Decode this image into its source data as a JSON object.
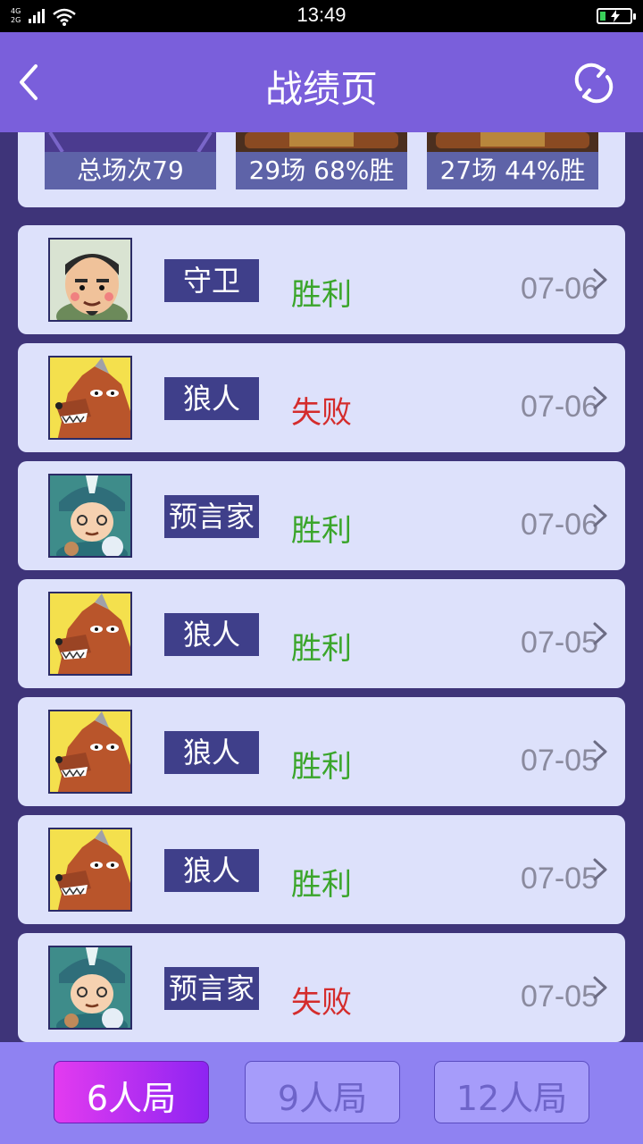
{
  "status_bar": {
    "network": "4G 2G",
    "time": "13:49"
  },
  "header": {
    "title": "战绩页"
  },
  "summary": {
    "stats": [
      {
        "label": "总场次79"
      },
      {
        "label": "29场 68%胜"
      },
      {
        "label": "27场 44%胜"
      }
    ]
  },
  "records": [
    {
      "role": "守卫",
      "result": "胜利",
      "outcome": "win",
      "date": "07-06",
      "avatar": "guard"
    },
    {
      "role": "狼人",
      "result": "失败",
      "outcome": "lose",
      "date": "07-06",
      "avatar": "werewolf"
    },
    {
      "role": "预言家",
      "result": "胜利",
      "outcome": "win",
      "date": "07-06",
      "avatar": "seer"
    },
    {
      "role": "狼人",
      "result": "胜利",
      "outcome": "win",
      "date": "07-05",
      "avatar": "werewolf"
    },
    {
      "role": "狼人",
      "result": "胜利",
      "outcome": "win",
      "date": "07-05",
      "avatar": "werewolf"
    },
    {
      "role": "狼人",
      "result": "胜利",
      "outcome": "win",
      "date": "07-05",
      "avatar": "werewolf"
    },
    {
      "role": "预言家",
      "result": "失败",
      "outcome": "lose",
      "date": "07-05",
      "avatar": "seer"
    }
  ],
  "tabs": [
    {
      "label": "6人局",
      "active": true
    },
    {
      "label": "9人局",
      "active": false
    },
    {
      "label": "12人局",
      "active": false
    }
  ],
  "colors": {
    "header": "#7a5fdb",
    "win": "#3aa52a",
    "lose": "#d42c2c",
    "card": "#dde1fb"
  }
}
